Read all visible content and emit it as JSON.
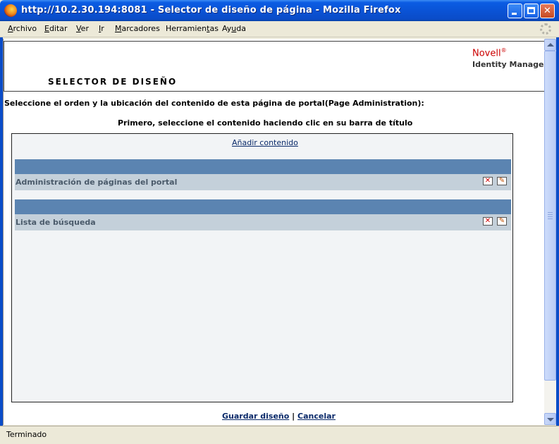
{
  "window": {
    "title": "http://10.2.30.194:8081 - Selector de diseño de página - Mozilla Firefox"
  },
  "menu": {
    "items": [
      {
        "label": "Archivo",
        "underline": "A",
        "rest": "rchivo"
      },
      {
        "label": "Editar",
        "underline": "E",
        "rest": "ditar"
      },
      {
        "label": "Ver",
        "underline": "V",
        "rest": "er"
      },
      {
        "label": "Ir",
        "underline": "I",
        "rest": "r"
      },
      {
        "label": "Marcadores",
        "underline": "M",
        "rest": "arcadores"
      },
      {
        "label": "Herramientas",
        "pre": "Herramien",
        "underline": "t",
        "rest": "as"
      },
      {
        "label": "Ayuda",
        "pre": "Ay",
        "underline": "u",
        "rest": "da"
      }
    ]
  },
  "header": {
    "brand": "Novell",
    "brand_mark": "®",
    "product": "Identity Manager",
    "page_title": "SELECTOR DE DISEÑO"
  },
  "instructions": {
    "line1": "Seleccione el orden y la ubicación del contenido de esta página de portal(Page Administration):",
    "line2": "Primero, seleccione el contenido haciendo clic en su barra de título"
  },
  "panel": {
    "add_content": "Añadir contenido",
    "items": [
      {
        "label": "Administración de páginas del portal"
      },
      {
        "label": "Lista de búsqueda"
      }
    ]
  },
  "footer": {
    "save": "Guardar diseño",
    "separator": "|",
    "cancel": "Cancelar"
  },
  "status": {
    "text": "Terminado"
  },
  "colors": {
    "title_bar": "#0a53d6",
    "portlet_title": "#5b84b1",
    "portlet_row": "#c4d0da",
    "brand": "#cc0000"
  }
}
